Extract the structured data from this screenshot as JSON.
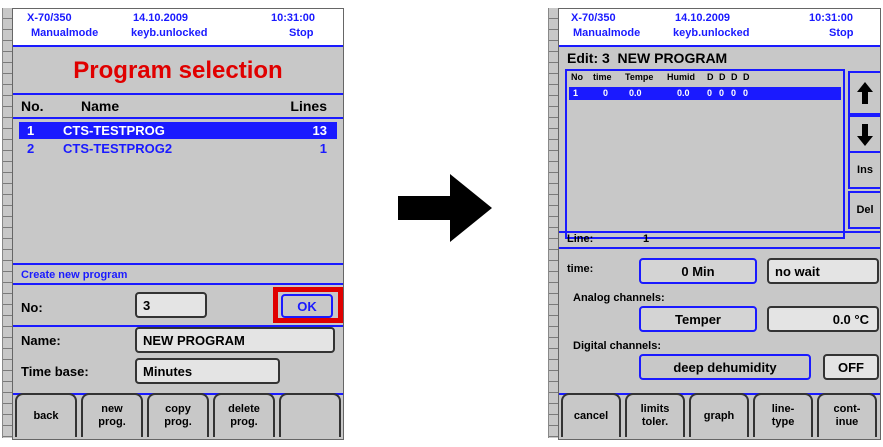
{
  "left": {
    "header": {
      "model": "X-70/350",
      "date": "14.10.2009",
      "time": "10:31:00",
      "mode": "Manualmode",
      "keyb": "keyb.unlocked",
      "state": "Stop"
    },
    "title": "Program selection",
    "columns": {
      "no": "No.",
      "name": "Name",
      "lines": "Lines"
    },
    "programs": [
      {
        "no": "1",
        "name": "CTS-TESTPROG",
        "lines": "13"
      },
      {
        "no": "2",
        "name": "CTS-TESTPROG2",
        "lines": "1"
      }
    ],
    "create_label": "Create new program",
    "form": {
      "no_label": "No:",
      "no_value": "3",
      "ok_label": "OK",
      "name_label": "Name:",
      "name_value": "NEW PROGRAM",
      "timebase_label": "Time base:",
      "timebase_value": "Minutes"
    },
    "softkeys": [
      "back",
      "new\nprog.",
      "copy\nprog.",
      "delete\nprog.",
      ""
    ]
  },
  "right": {
    "header": {
      "model": "X-70/350",
      "date": "14.10.2009",
      "time": "10:31:00",
      "mode": "Manualmode",
      "keyb": "keyb.unlocked",
      "state": "Stop"
    },
    "edit_title": "Edit: 3  NEW PROGRAM",
    "columns": [
      "No",
      "time",
      "Tempe",
      "Humid",
      "D",
      "D",
      "D",
      "D"
    ],
    "row": [
      "1",
      "0",
      "0.0",
      "0.0",
      "0",
      "0",
      "0",
      "0"
    ],
    "side": {
      "ins": "Ins",
      "del": "Del"
    },
    "line_label": "Line:",
    "line_value": "1",
    "time_label": "time:",
    "time_value": "0 Min",
    "wait_value": "no wait",
    "analog_label": "Analog channels:",
    "analog_name": "Temper",
    "analog_value": "0.0 °C",
    "digital_label": "Digital channels:",
    "digital_name": "deep dehumidity",
    "digital_state": "OFF",
    "softkeys": [
      "cancel",
      "limits\ntoler.",
      "graph",
      "line-\ntype",
      "cont-\ninue"
    ]
  },
  "colors": {
    "accent": "#1a1aff",
    "title": "#e00000",
    "highlight": "#e00000",
    "panel": "#c8c8c8"
  }
}
